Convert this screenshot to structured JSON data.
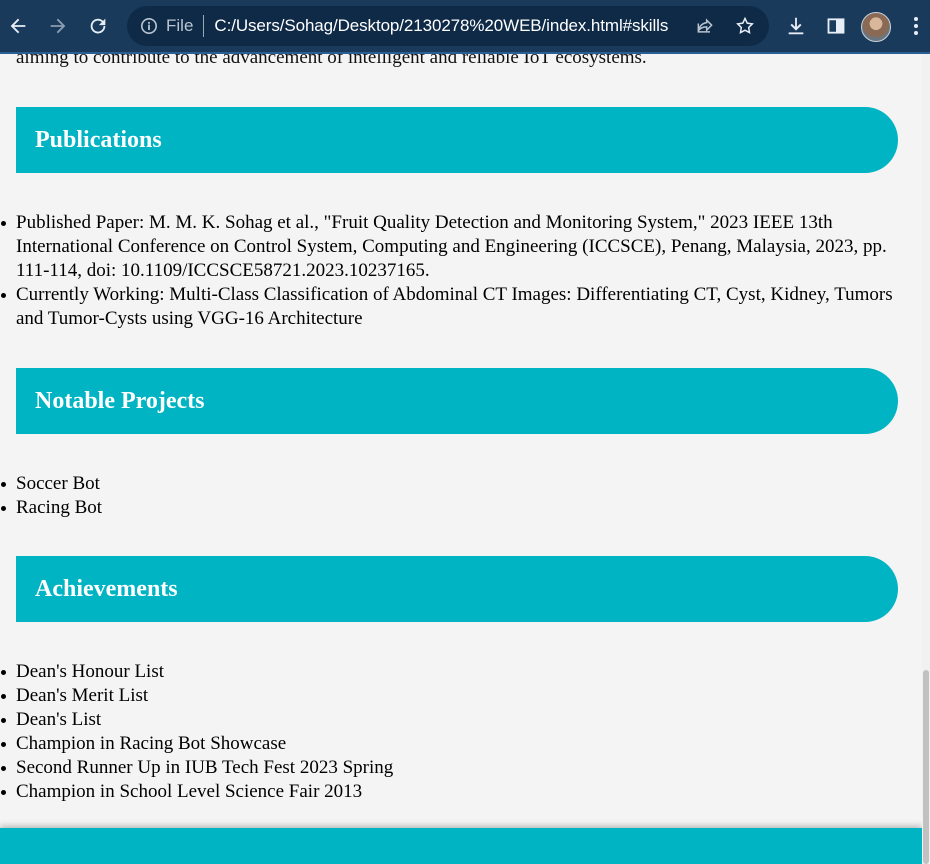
{
  "browser": {
    "file_label": "File",
    "url": "C:/Users/Sohag/Desktop/2130278%20WEB/index.html#skills",
    "icons": [
      "back-arrow-icon",
      "forward-arrow-icon",
      "reload-icon",
      "info-icon",
      "share-icon",
      "star-icon",
      "download-icon",
      "side-panel-icon",
      "profile-avatar",
      "more-menu-icon"
    ]
  },
  "page": {
    "intro_tail": "aiming to contribute to the advancement of intelligent and reliable IoT ecosystems.",
    "sections": [
      {
        "title": "Publications",
        "items": [
          "Published Paper: M. M. K. Sohag et al., \"Fruit Quality Detection and Monitoring System,\" 2023 IEEE 13th International Conference on Control System, Computing and Engineering (ICCSCE), Penang, Malaysia, 2023, pp. 111-114, doi: 10.1109/ICCSCE58721.2023.10237165.",
          "Currently Working: Multi-Class Classification of Abdominal CT Images: Differentiating CT, Cyst, Kidney, Tumors and Tumor-Cysts using VGG-16 Architecture"
        ]
      },
      {
        "title": "Notable Projects",
        "items": [
          "Soccer Bot",
          "Racing Bot"
        ]
      },
      {
        "title": "Achievements",
        "items": [
          "Dean's Honour List",
          "Dean's Merit List",
          "Dean's List",
          "Champion in Racing Bot Showcase",
          "Second Runner Up in IUB Tech Fest 2023 Spring",
          "Champion in School Level Science Fair 2013"
        ]
      }
    ]
  },
  "colors": {
    "accent": "#00b4c4",
    "toolbar": "#1a3a5c",
    "page_bg": "#f4f4f4"
  }
}
